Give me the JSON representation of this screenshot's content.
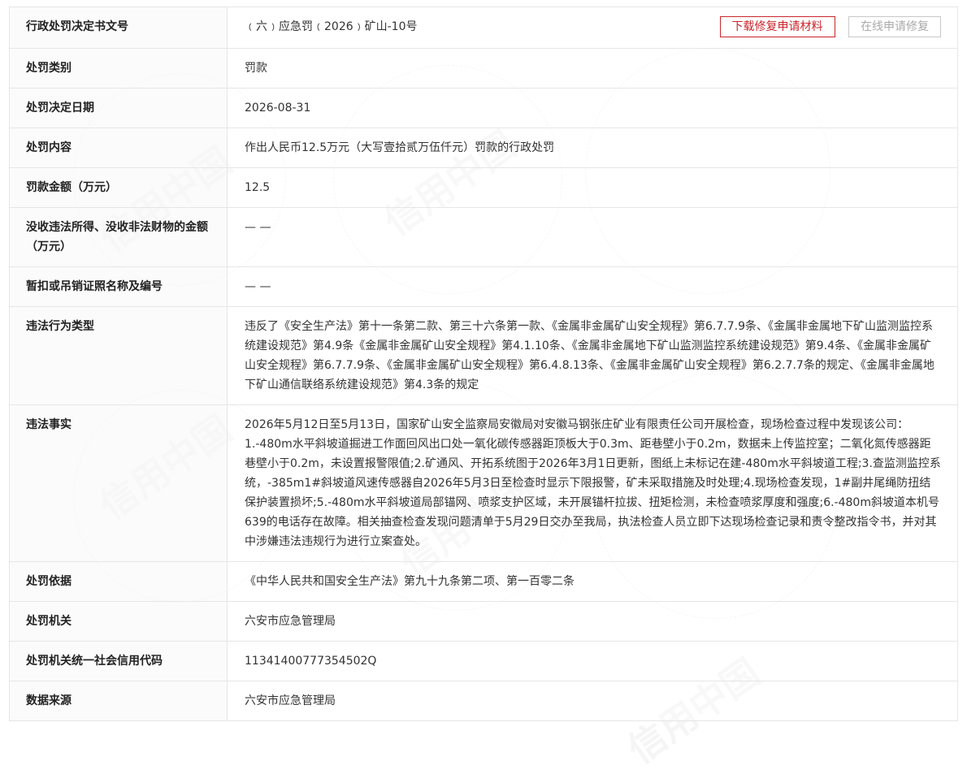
{
  "watermark_text": "信用中国",
  "rows": [
    {
      "label": "行政处罚决定书文号",
      "value": "﹙六﹚应急罚﹙2026﹚矿山-10号"
    },
    {
      "label": "处罚类别",
      "value": "罚款"
    },
    {
      "label": "处罚决定日期",
      "value": "2026-08-31"
    },
    {
      "label": "处罚内容",
      "value": "作出人民币12.5万元（大写壹拾贰万伍仟元）罚款的行政处罚"
    },
    {
      "label": "罚款金额（万元）",
      "value": "12.5"
    },
    {
      "label": "没收违法所得、没收非法财物的金额（万元）",
      "value": "— —"
    },
    {
      "label": "暂扣或吊销证照名称及编号",
      "value": "— —"
    },
    {
      "label": "违法行为类型",
      "value": "违反了《安全生产法》第十一条第二款、第三十六条第一款、《金属非金属矿山安全规程》第6.7.7.9条、《金属非金属地下矿山监测监控系统建设规范》第4.9条《金属非金属矿山安全规程》第4.1.10条、《金属非金属地下矿山监测监控系统建设规范》第9.4条、《金属非金属矿山安全规程》第6.7.7.9条、《金属非金属矿山安全规程》第6.4.8.13条、《金属非金属矿山安全规程》第6.2.7.7条的规定、《金属非金属地下矿山通信联络系统建设规范》第4.3条的规定"
    },
    {
      "label": "违法事实",
      "value": "2026年5月12日至5月13日，国家矿山安全监察局安徽局对安徽马钢张庄矿业有限责任公司开展检查，现场检查过程中发现该公司：1.-480m水平斜坡道掘进工作面回风出口处一氧化碳传感器距顶板大于0.3m、距巷壁小于0.2m，数据未上传监控室；二氧化氮传感器距巷壁小于0.2m，未设置报警限值;2.矿通风、开拓系统图于2026年3月1日更新，图纸上未标记在建-480m水平斜坡道工程;3.查监测监控系统，-385m1#斜坡道风速传感器自2026年5月3日至检查时显示下限报警，矿未采取措施及时处理;4.现场检查发现，1#副井尾绳防扭结保护装置损坏;5.-480m水平斜坡道局部锚网、喷浆支护区域，未开展锚杆拉拔、扭矩检测，未检查喷浆厚度和强度;6.-480m斜坡道本机号639的电话存在故障。相关抽查检查发现问题清单于5月29日交办至我局，执法检查人员立即下达现场检查记录和责令整改指令书，并对其中涉嫌违法违规行为进行立案查处。"
    },
    {
      "label": "处罚依据",
      "value": "《中华人民共和国安全生产法》第九十九条第二项、第一百零二条"
    },
    {
      "label": "处罚机关",
      "value": "六安市应急管理局"
    },
    {
      "label": "处罚机关统一社会信用代码",
      "value": "11341400777354502Q"
    },
    {
      "label": "数据来源",
      "value": "六安市应急管理局"
    }
  ],
  "buttons": {
    "download_label": "下载修复申请材料",
    "online_label": "在线申请修复"
  }
}
